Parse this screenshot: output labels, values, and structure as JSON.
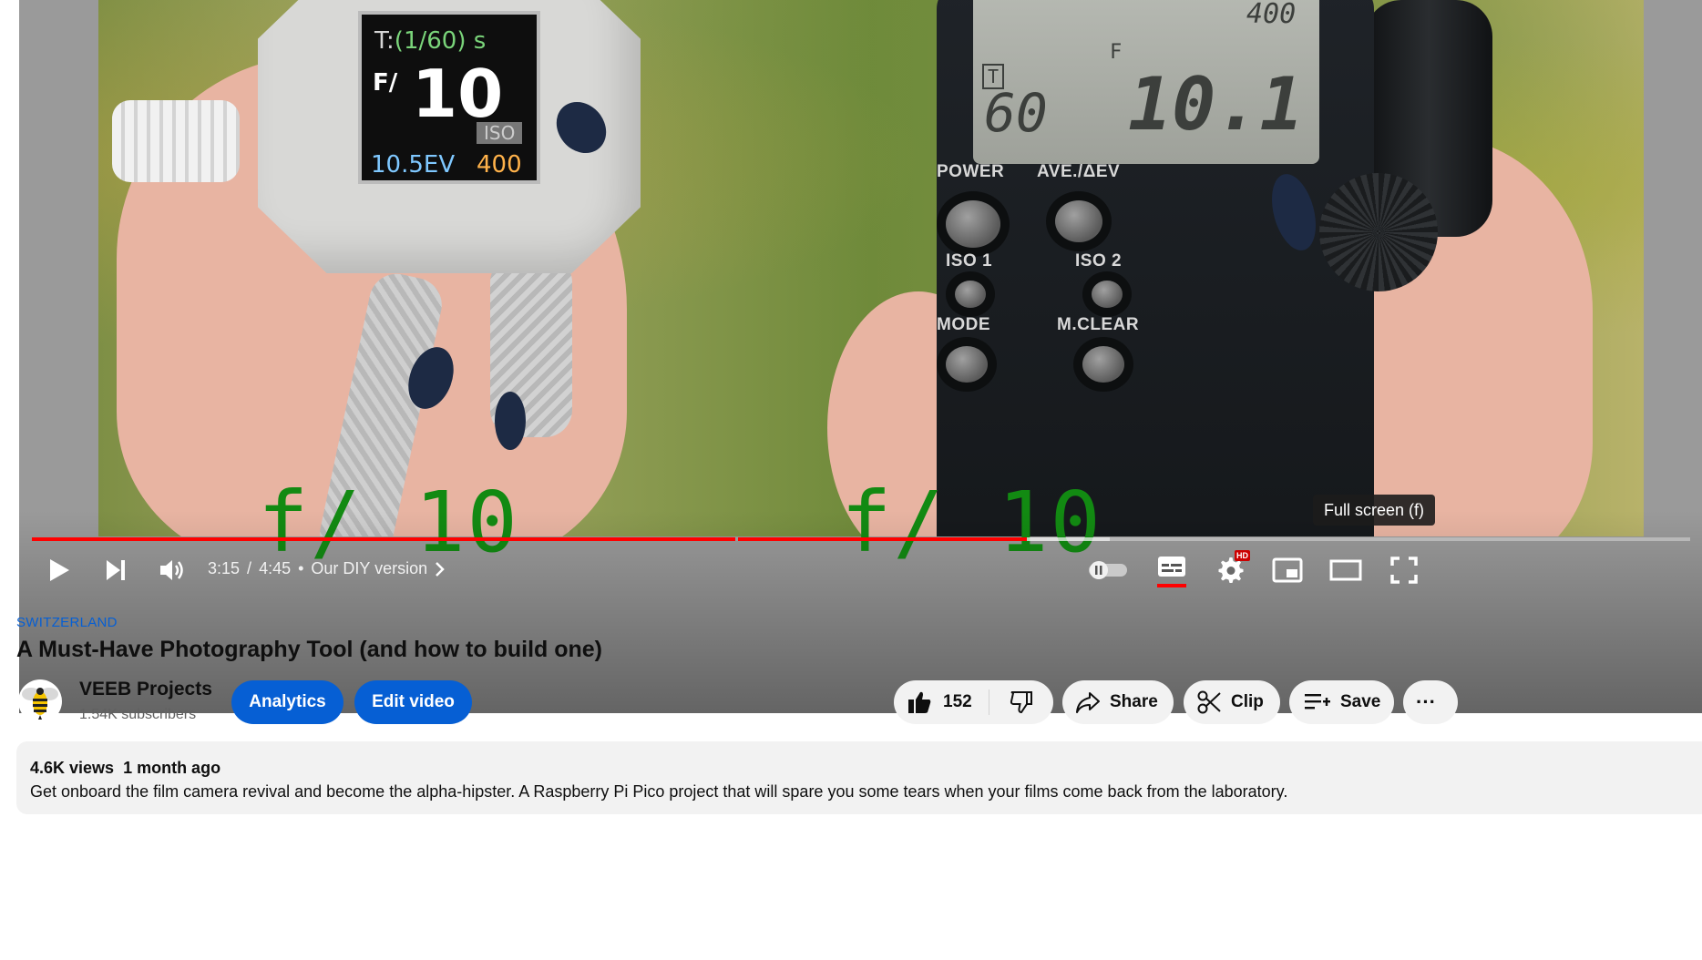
{
  "video_frame": {
    "diy_meter": {
      "shutter_prefix": "T:",
      "shutter_value": "(1/60) s",
      "aperture_prefix": "F/",
      "aperture_value": "10",
      "iso_label": "ISO",
      "ev_value": "10.5EV",
      "iso_value": "400"
    },
    "pro_meter": {
      "lcd_iso": "400",
      "lcd_f": "F",
      "lcd_t": "T",
      "lcd_shutter": "60",
      "lcd_aperture": "10.1",
      "power_label": "POWER",
      "ave_label": "AVE./ΔEV",
      "iso1_label": "ISO 1",
      "iso2_label": "ISO 2",
      "mode_label": "MODE",
      "mclear_label": "M.CLEAR"
    },
    "caption_left": "f/ 10",
    "caption_right": "f/ 10"
  },
  "player": {
    "progress_fraction": 0.6,
    "buffer_fraction": 0.65,
    "current_time": "3:15",
    "duration": "4:45",
    "time_separator": "/",
    "dot": "•",
    "chapter_title": "Our DIY version",
    "hd_badge": "HD",
    "tooltip": "Full screen (f)",
    "colors": {
      "played": "#ff0000",
      "accent": "#065fd4"
    }
  },
  "video": {
    "location": "SWITZERLAND",
    "title": "A Must-Have Photography Tool (and how to build one)",
    "channel_name": "VEEB Projects",
    "subscribers": "1.54K subscribers",
    "analytics_label": "Analytics",
    "edit_label": "Edit video",
    "likes": "152",
    "share_label": "Share",
    "clip_label": "Clip",
    "save_label": "Save",
    "more_label": "···",
    "views": "4.6K views",
    "published": "1 month ago",
    "description": "Get onboard the film camera revival and become the alpha-hipster. A Raspberry Pi Pico project that will spare you some tears when your films come back from the laboratory."
  }
}
